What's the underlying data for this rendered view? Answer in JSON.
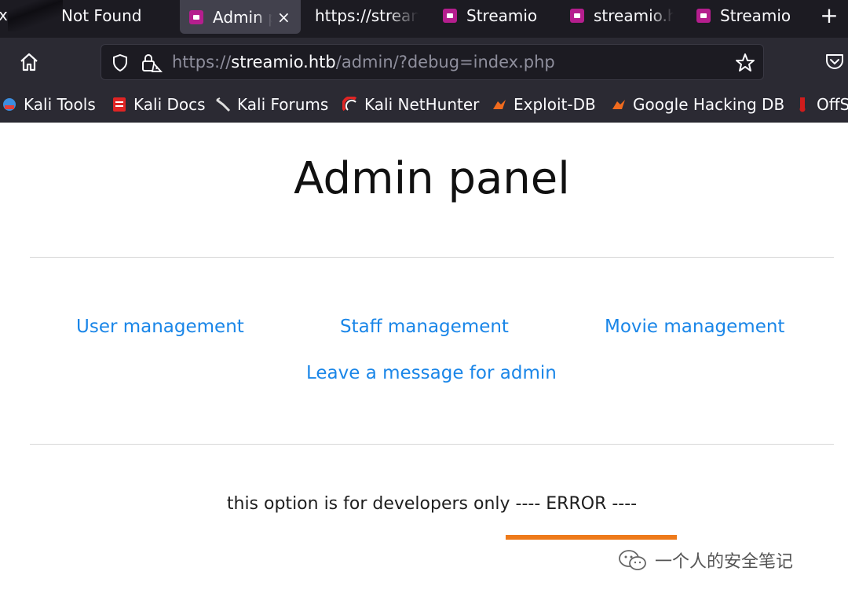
{
  "browser": {
    "tabs": [
      {
        "label": "x",
        "active": false
      },
      {
        "label": "Not Found",
        "active": false
      },
      {
        "label": "Admin p",
        "active": true
      },
      {
        "label": "https://strean",
        "active": false
      },
      {
        "label": "Streamio",
        "active": false
      },
      {
        "label": "streamio.h",
        "active": false
      },
      {
        "label": "Streamio",
        "active": false
      }
    ],
    "new_tab_label": "+",
    "close_tab_label": "×",
    "url": {
      "scheme": "https://",
      "host": "streamio.htb",
      "path": "/admin/?debug=index.php"
    },
    "bookmarks": [
      {
        "label": "Kali Tools",
        "icon": "kali-tools-icon"
      },
      {
        "label": "Kali Docs",
        "icon": "kali-docs-icon"
      },
      {
        "label": "Kali Forums",
        "icon": "kali-forums-icon"
      },
      {
        "label": "Kali NetHunter",
        "icon": "kali-nethunter-icon"
      },
      {
        "label": "Exploit-DB",
        "icon": "exploit-db-icon"
      },
      {
        "label": "Google Hacking DB",
        "icon": "ghdb-icon"
      },
      {
        "label": "OffS",
        "icon": "offsec-icon"
      }
    ]
  },
  "page": {
    "title": "Admin panel",
    "links": {
      "user_management": "User management",
      "staff_management": "Staff management",
      "movie_management": "Movie management",
      "leave_message": "Leave a message for admin"
    },
    "debug_message": "this option is for developers only ---- ERROR ----"
  },
  "watermark": {
    "text": "一个人的安全笔记"
  },
  "colors": {
    "link": "#1a86e8",
    "highlight_underline": "#ee7a1a",
    "favicon": "#b51e8e",
    "tab_bar": "#1c1b22",
    "toolbar": "#2b2a33"
  }
}
